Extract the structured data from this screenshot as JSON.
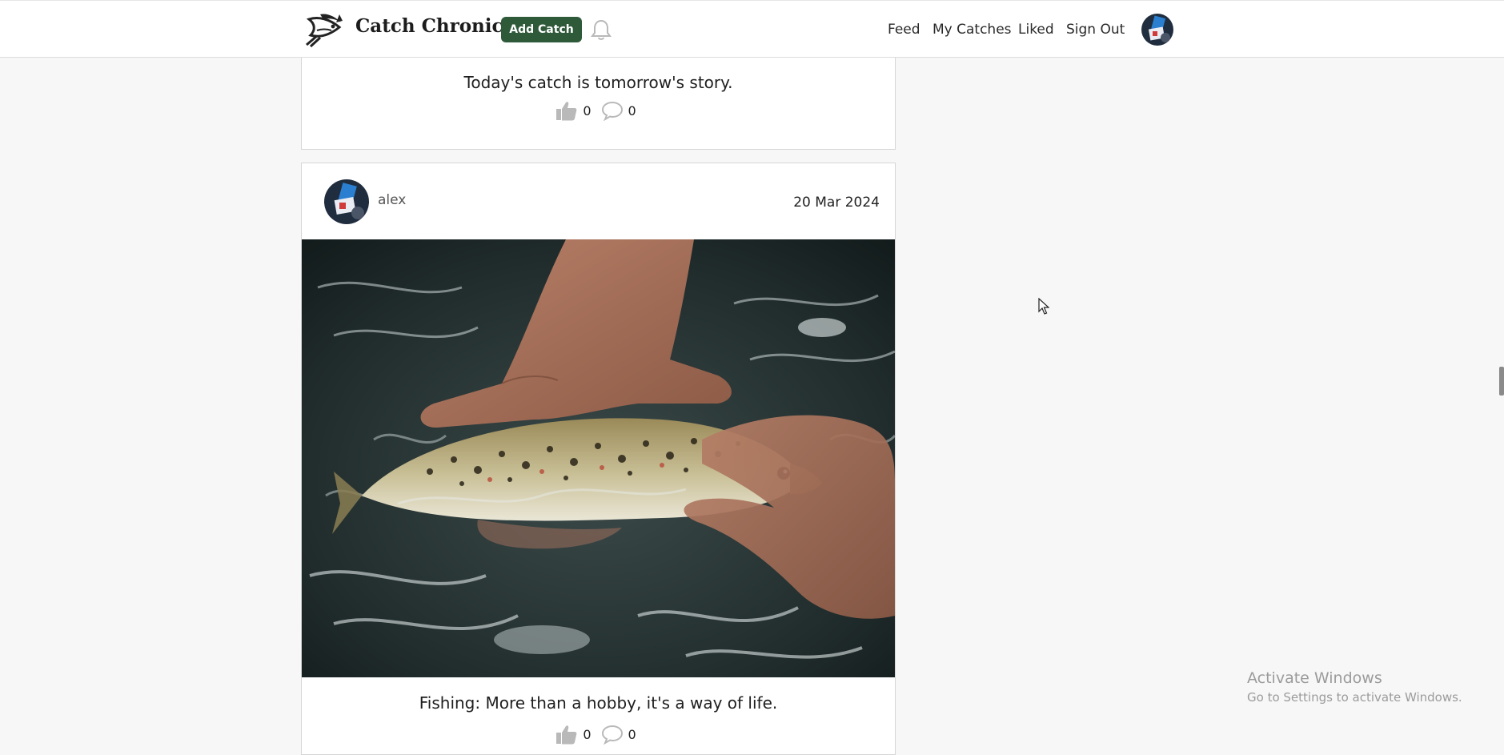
{
  "header": {
    "brand": "Catch Chronicle",
    "add_button": "Add Catch",
    "nav": {
      "feed": "Feed",
      "my_catches": "My Catches",
      "liked": "Liked",
      "sign_out": "Sign Out"
    },
    "icons": [
      "fish-logo-icon",
      "bell-icon",
      "avatar"
    ]
  },
  "feed": {
    "posts": [
      {
        "caption": "Today's catch is tomorrow's story.",
        "likes": "0",
        "comments": "0"
      },
      {
        "username": "alex",
        "date": "20 Mar 2024",
        "caption": "Fishing: More than a hobby, it's a way of life.",
        "likes": "0",
        "comments": "0"
      }
    ]
  },
  "watermark": {
    "title": "Activate Windows",
    "subtitle": "Go to Settings to activate Windows."
  },
  "colors": {
    "accent": "#2f5a3a",
    "background": "#f7f7f7",
    "card": "#ffffff",
    "icon_gray": "#b9b9b9"
  }
}
